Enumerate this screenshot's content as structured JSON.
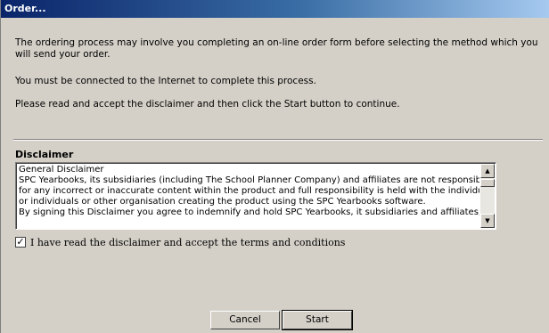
{
  "window": {
    "title": "Order..."
  },
  "intro": {
    "p1": "The ordering process may involve you completing an on-line order form before selecting the method which you will send your order.",
    "p2": "You must be connected to the Internet to complete this process.",
    "p3": "Please read and accept the disclaimer and then click the Start button to continue."
  },
  "disclaimer": {
    "heading": "Disclaimer",
    "lines": [
      "General Disclaimer",
      "SPC Yearbooks, its subsidiaries (including The School Planner Company) and affiliates are not responsible",
      "for any incorrect or inaccurate content within the product and full responsibility is held with the individual",
      "or individuals or other organisation creating the product using the SPC Yearbooks software.",
      "By signing this Disclaimer you agree to indemnify and hold SPC Yearbooks, it subsidiaries and affiliates,"
    ]
  },
  "accept": {
    "checked": true,
    "label": "I have read the disclaimer and accept the terms and conditions"
  },
  "buttons": {
    "cancel": "Cancel",
    "start": "Start"
  },
  "icons": {
    "scroll_up": "scroll-up-arrow-icon",
    "scroll_down": "scroll-down-arrow-icon",
    "check": "check-icon"
  }
}
